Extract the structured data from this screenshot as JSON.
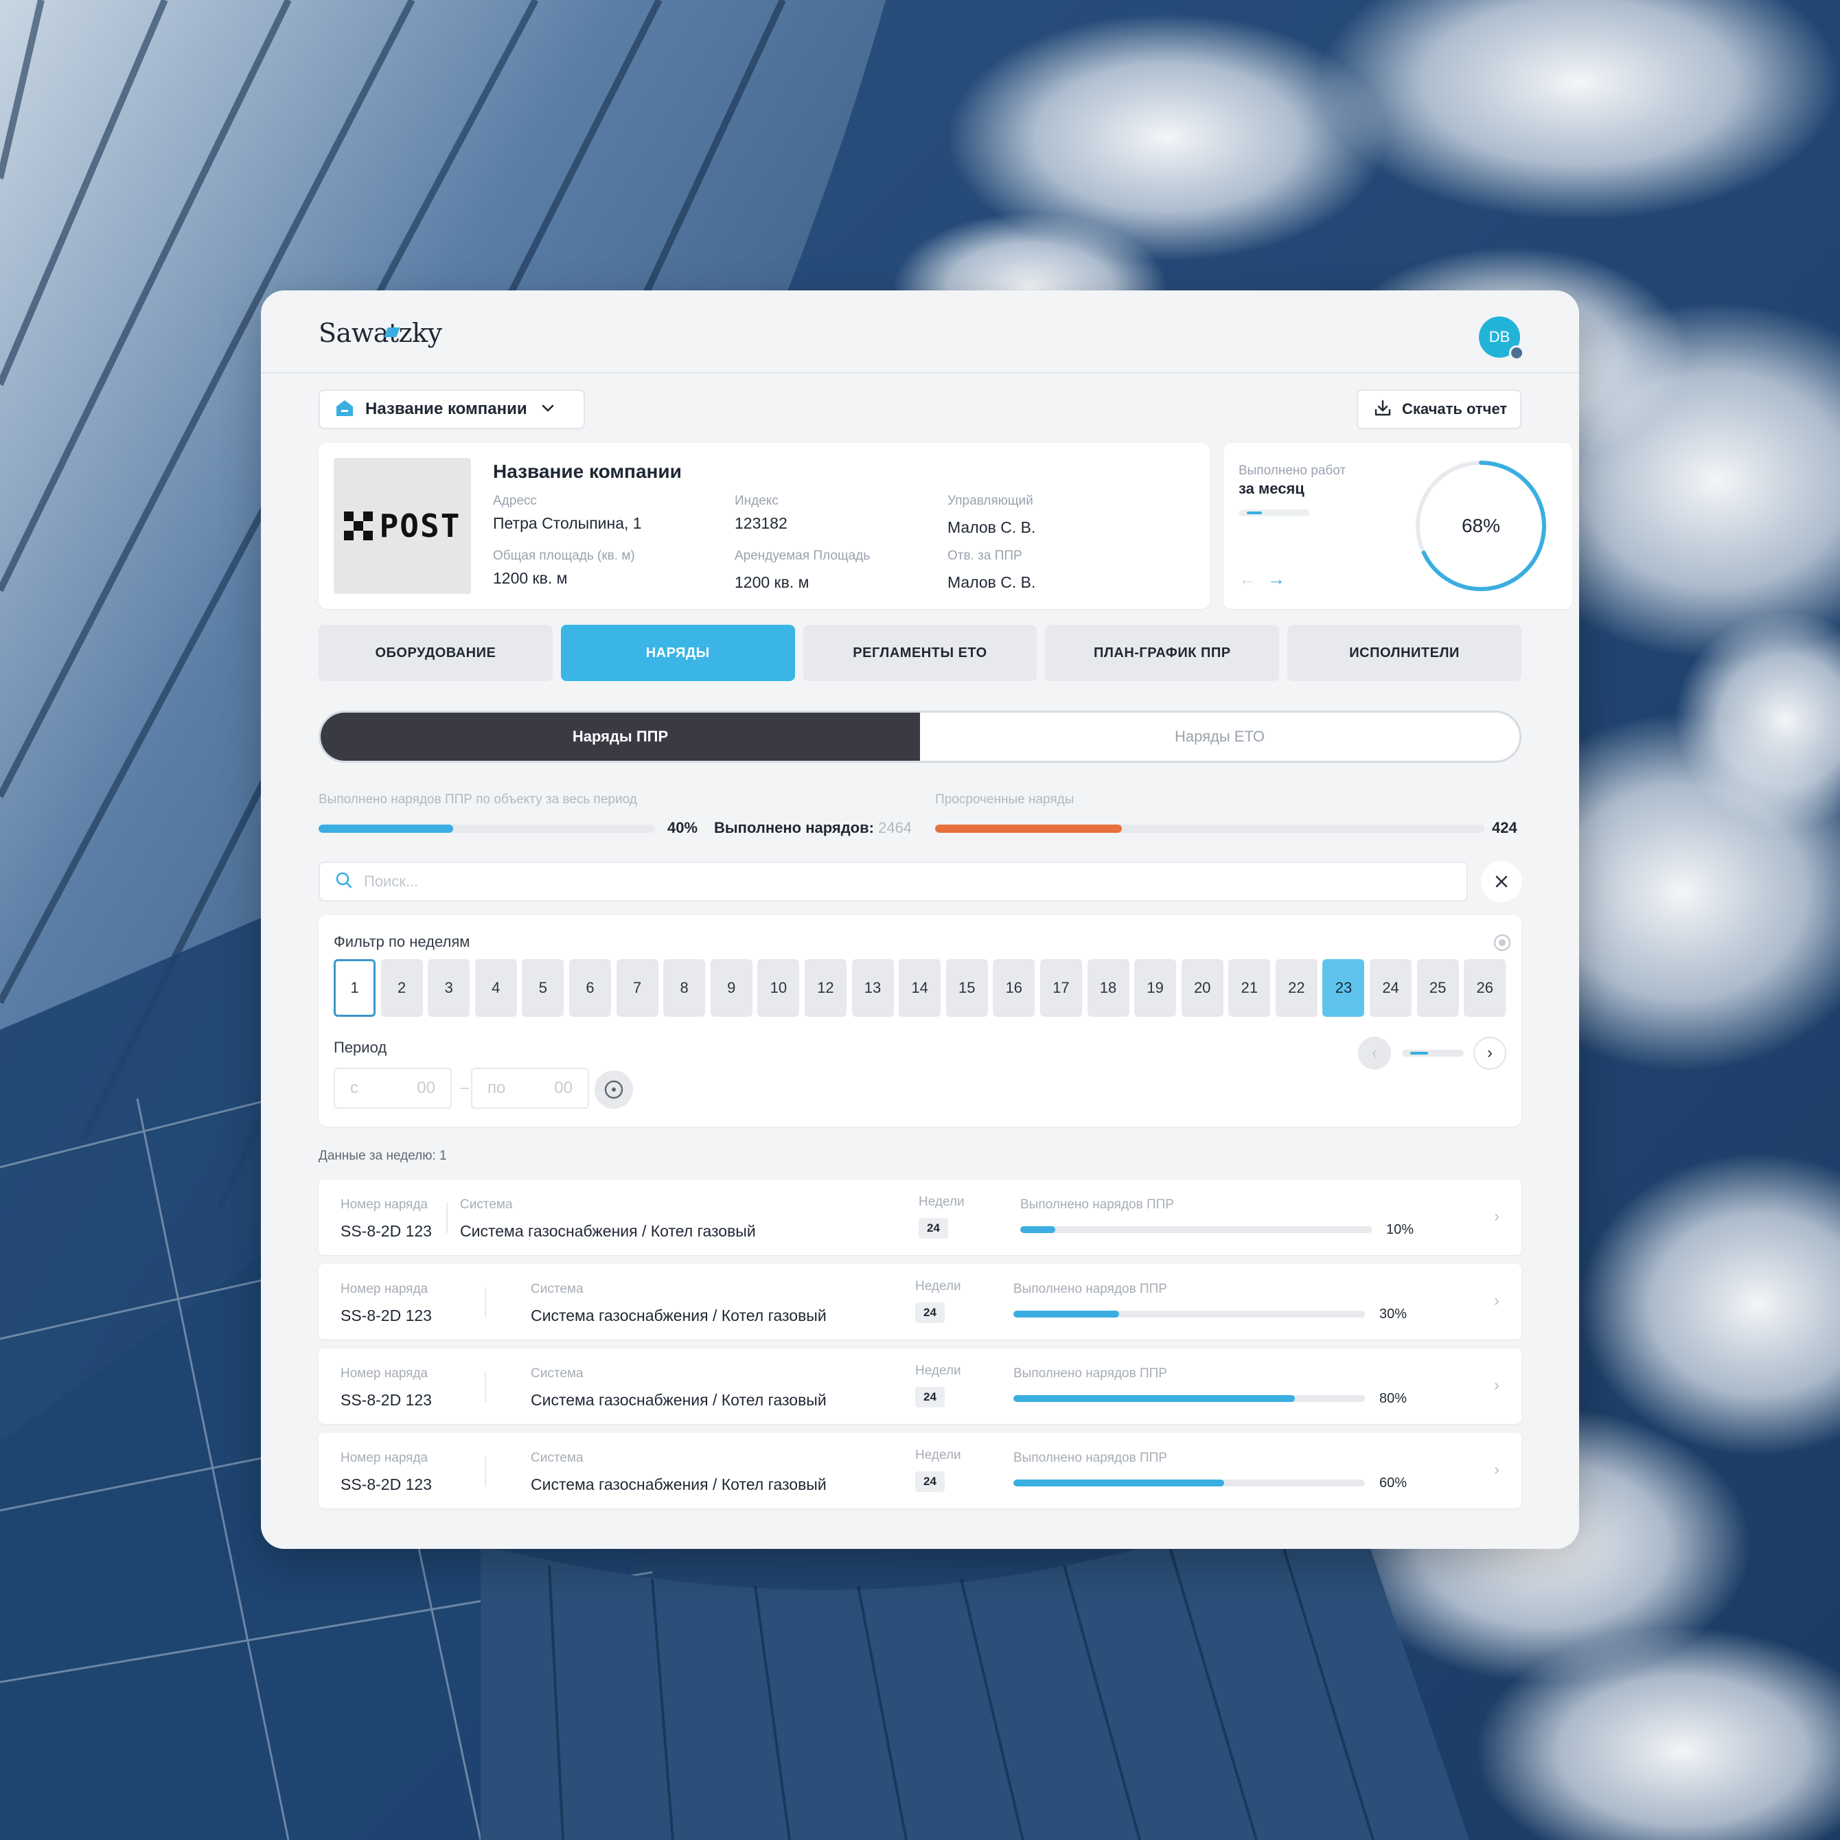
{
  "brand": {
    "logo_text": "Sawatzky",
    "avatar_initials": "DB"
  },
  "company_select": {
    "label": "Название компании",
    "icon": "building-icon"
  },
  "download_button": {
    "label": "Скачать отчет",
    "icon": "download-icon"
  },
  "company": {
    "name": "Название компании",
    "logo_text": "POST",
    "address_label": "Адресс",
    "address_value": "Петра Столыпина, 1",
    "index_label": "Индекс",
    "index_value": "123182",
    "manager_label": "Управляющий",
    "manager_value": "Малов С. В.",
    "area_label": "Общая площадь (кв. м)",
    "area_value": "1200 кв. м",
    "rent_area_label": "Арендуемая Площадь",
    "rent_area_value": "1200 кв. м",
    "ppr_resp_label": "Отв. за ППР",
    "ppr_resp_value": "Малов С. В."
  },
  "progress_card": {
    "title": "Выполнено работ",
    "subtitle": "за месяц",
    "percent_label": "68%",
    "percent_value": 68,
    "accent": "#3aaee0"
  },
  "tabs": [
    {
      "label": "ОБОРУДОВАНИЕ",
      "active": false
    },
    {
      "label": "НАРЯДЫ",
      "active": true
    },
    {
      "label": "РЕГЛАМЕНТЫ ЕТО",
      "active": false
    },
    {
      "label": "ПЛАН-ГРАФИК ППР",
      "active": false
    },
    {
      "label": "ИСПОЛНИТЕЛИ",
      "active": false
    }
  ],
  "segment": {
    "left": "Наряды ППР",
    "right": "Наряды ЕТО"
  },
  "stats": {
    "done_title": "Выполнено нарядов ППР по объекту за весь период",
    "done_percent_label": "40%",
    "done_percent": 40,
    "done_count_label": "Выполнено нарядов:",
    "done_count": "2464",
    "overdue_title": "Просроченные наряды",
    "overdue_value": "424",
    "overdue_fill": 34,
    "done_color": "#3aaee0",
    "overdue_color": "#e8703d"
  },
  "search": {
    "placeholder": "Поиск..."
  },
  "filter": {
    "title": "Фильтр по неделям",
    "weeks": [
      "1",
      "2",
      "3",
      "4",
      "5",
      "6",
      "7",
      "8",
      "9",
      "10",
      "12",
      "13",
      "14",
      "15",
      "16",
      "17",
      "18",
      "19",
      "20",
      "21",
      "22",
      "23",
      "24",
      "25",
      "26"
    ],
    "selected_week": "1",
    "highlighted_week": "23",
    "period_title": "Период",
    "from_placeholder": "с",
    "to_placeholder": "по",
    "from_value": "00",
    "to_value": "00"
  },
  "week_data_label": "Данные за неделю: 1",
  "orders": {
    "order_label": "Номер наряда",
    "system_label": "Система",
    "weeks_label": "Недели",
    "progress_label": "Выполнено нарядов ППР",
    "items": [
      {
        "number": "SS-8-2D 123",
        "system": "Система газоснабжения / Котел газовый",
        "weeks": "24",
        "percent_label": "10%",
        "percent": 10
      },
      {
        "number": "SS-8-2D 123",
        "system": "Система газоснабжения / Котел газовый",
        "weeks": "24",
        "percent_label": "30%",
        "percent": 30
      },
      {
        "number": "SS-8-2D 123",
        "system": "Система газоснабжения / Котел газовый",
        "weeks": "24",
        "percent_label": "80%",
        "percent": 80
      },
      {
        "number": "SS-8-2D 123",
        "system": "Система газоснабжения / Котел газовый",
        "weeks": "24",
        "percent_label": "60%",
        "percent": 60
      }
    ]
  }
}
